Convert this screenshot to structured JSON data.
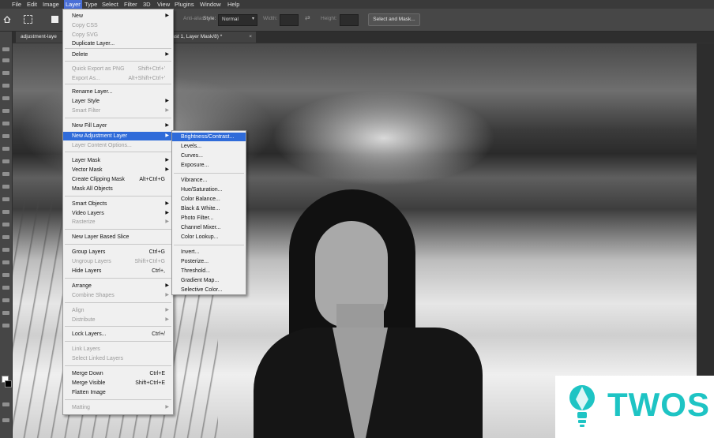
{
  "menubar": {
    "items": [
      "File",
      "Edit",
      "Image",
      "Layer",
      "Type",
      "Select",
      "Filter",
      "3D",
      "View",
      "Plugins",
      "Window",
      "Help"
    ],
    "active_index": 3
  },
  "options": {
    "antialias": "Anti-alias",
    "style_label": "Style:",
    "style_value": "Normal",
    "width_label": "Width:",
    "height_label": "Height:",
    "select_mask": "Select and Mask..."
  },
  "tabs": {
    "tab1": "adjustment-laye",
    "tab2": "ast 1, Layer Mask/8) *",
    "tab2_close": "×"
  },
  "layer_menu": {
    "items": [
      {
        "label": "New",
        "submenu": true
      },
      {
        "label": "Copy CSS",
        "disabled": true
      },
      {
        "label": "Copy SVG",
        "disabled": true
      },
      {
        "label": "Duplicate Layer..."
      },
      {
        "label": "Delete",
        "submenu": true
      },
      {
        "label": "Quick Export as PNG",
        "shortcut": "Shift+Ctrl+'",
        "disabled": true
      },
      {
        "label": "Export As...",
        "shortcut": "Alt+Shift+Ctrl+'",
        "disabled": true
      },
      {
        "label": "Rename Layer..."
      },
      {
        "label": "Layer Style",
        "submenu": true
      },
      {
        "label": "Smart Filter",
        "submenu": true,
        "disabled": true
      },
      {
        "label": "New Fill Layer",
        "submenu": true
      },
      {
        "label": "New Adjustment Layer",
        "submenu": true,
        "highlighted": true
      },
      {
        "label": "Layer Content Options...",
        "disabled": true
      },
      {
        "label": "Layer Mask",
        "submenu": true
      },
      {
        "label": "Vector Mask",
        "submenu": true
      },
      {
        "label": "Create Clipping Mask",
        "shortcut": "Alt+Ctrl+G"
      },
      {
        "label": "Mask All Objects"
      },
      {
        "label": "Smart Objects",
        "submenu": true
      },
      {
        "label": "Video Layers",
        "submenu": true
      },
      {
        "label": "Rasterize",
        "submenu": true,
        "disabled": true
      },
      {
        "label": "New Layer Based Slice"
      },
      {
        "label": "Group Layers",
        "shortcut": "Ctrl+G"
      },
      {
        "label": "Ungroup Layers",
        "shortcut": "Shift+Ctrl+G",
        "disabled": true
      },
      {
        "label": "Hide Layers",
        "shortcut": "Ctrl+,"
      },
      {
        "label": "Arrange",
        "submenu": true
      },
      {
        "label": "Combine Shapes",
        "submenu": true,
        "disabled": true
      },
      {
        "label": "Align",
        "submenu": true,
        "disabled": true
      },
      {
        "label": "Distribute",
        "submenu": true,
        "disabled": true
      },
      {
        "label": "Lock Layers...",
        "shortcut": "Ctrl+/"
      },
      {
        "label": "Link Layers",
        "disabled": true
      },
      {
        "label": "Select Linked Layers",
        "disabled": true
      },
      {
        "label": "Merge Down",
        "shortcut": "Ctrl+E"
      },
      {
        "label": "Merge Visible",
        "shortcut": "Shift+Ctrl+E"
      },
      {
        "label": "Flatten Image"
      },
      {
        "label": "Matting",
        "submenu": true,
        "disabled": true
      }
    ]
  },
  "adjustment_menu": {
    "items": [
      {
        "label": "Brightness/Contrast...",
        "highlighted": true
      },
      {
        "label": "Levels..."
      },
      {
        "label": "Curves..."
      },
      {
        "label": "Exposure..."
      },
      {
        "label": "Vibrance..."
      },
      {
        "label": "Hue/Saturation..."
      },
      {
        "label": "Color Balance..."
      },
      {
        "label": "Black & White..."
      },
      {
        "label": "Photo Filter..."
      },
      {
        "label": "Channel Mixer..."
      },
      {
        "label": "Color Lookup..."
      },
      {
        "label": "Invert..."
      },
      {
        "label": "Posterize..."
      },
      {
        "label": "Threshold..."
      },
      {
        "label": "Gradient Map..."
      },
      {
        "label": "Selective Color..."
      }
    ]
  },
  "watermark": {
    "text": "TWOS"
  },
  "colors": {
    "highlight": "#2f6bd9",
    "logo": "#1ec4c4"
  }
}
